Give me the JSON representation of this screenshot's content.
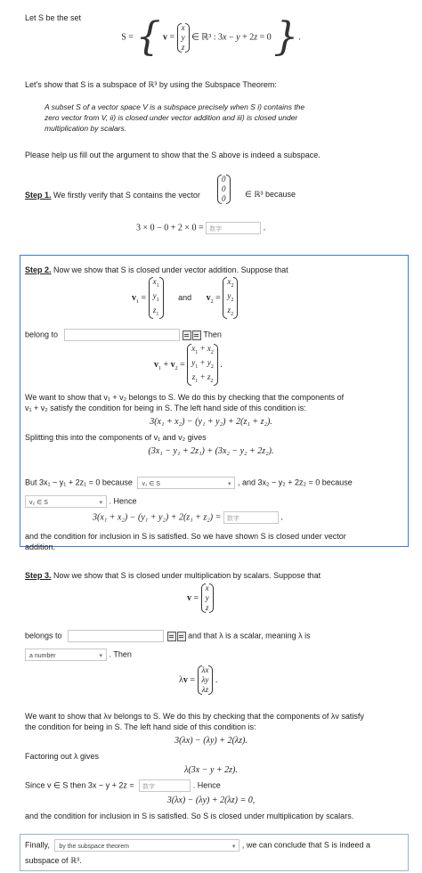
{
  "intro": {
    "let_line": "Let S be the set",
    "set_def": "S = { v = (x, y, z) ∈ ℝ³ : 3x − y + 2z = 0 }.",
    "lets_show": "Let's show that S is a subspace of ℝ³ by using the Subspace Theorem:",
    "theorem": [
      "A subset S of a vector space V is a subspace precisely when S i) contains the",
      "zero vector from V, ii) is closed under vector addition and iii) is closed under",
      "multiplication by scalars."
    ],
    "please_help": "Please help us fill out the argument to show that the S above is indeed a subspace."
  },
  "step1": {
    "label": "Step 1.",
    "text": "We firstly verify that S contains the vector",
    "because": "∈ ℝ³ because",
    "equation": "3 × 0 − 0 + 2 × 0 =",
    "answer_placeholder": "数字"
  },
  "step2": {
    "label": "Step 2.",
    "text": "Now we show that S is closed under vector addition. Suppose that",
    "and": "and",
    "belong_to": "belong to",
    "then": "Then",
    "want1": "We want to show that v₁ + v₂ belongs to S. We do this by checking that the components of",
    "want2": "v₁ + v₂ satisfy the condition for being in S. The left hand side of this condition is:",
    "lhs": "3(x₁ + x₂) − (y₁ + y₂) + 2(z₁ + z₂).",
    "splitting": "Splitting this into the components of v₁ and v₂ gives",
    "split_eq": "(3x₁ − y₁ + 2z₁) + (3x₂ − y₂ + 2z₂).",
    "but": "But 3x₁ − y₁ + 2z₁ = 0 because",
    "select1": "v₁ ∈ S",
    "and2": ", and 3x₂ − y₂ + 2z₂ = 0 because",
    "select2": "v₂ ∈ S",
    "hence": ". Hence",
    "hence_eq": "3(x₁ + x₂) − (y₁ + y₂) + 2(z₁ + z₂) =",
    "answer_placeholder": "数字",
    "conclusion1": "and the condition for inclusion in S is satisfied. So we have shown S is closed under vector",
    "conclusion2": "addition."
  },
  "step3": {
    "label": "Step 3.",
    "text": "Now we show that S is closed under multiplication by scalars. Suppose that",
    "belongs_to": "belongs to",
    "scalar_text": "and that λ is a scalar, meaning λ is",
    "select_scalar": "a number",
    "then": ". Then",
    "want1": "We want to show that λv belongs to S. We do this by checking that the components of λv satisfy",
    "want2": "the condition for being in S. The left hand side of this condition is:",
    "lhs": "3(λx) − (λy) + 2(λz).",
    "factoring": "Factoring out λ gives",
    "factored": "λ(3x − y + 2z).",
    "since": "Since v ∈ S then 3x − y + 2z =",
    "answer_placeholder": "数字",
    "hence": ". Hence",
    "hence_eq": "3(λx) − (λy) + 2(λz) = 0,",
    "conclusion": "and the condition for inclusion in S is satisfied. So S is closed under multiplication by scalars."
  },
  "final": {
    "finally": "Finally,",
    "select": "by the subspace theorem",
    "text": ", we can conclude that S is indeed a",
    "text2": "subspace of ℝ³."
  }
}
